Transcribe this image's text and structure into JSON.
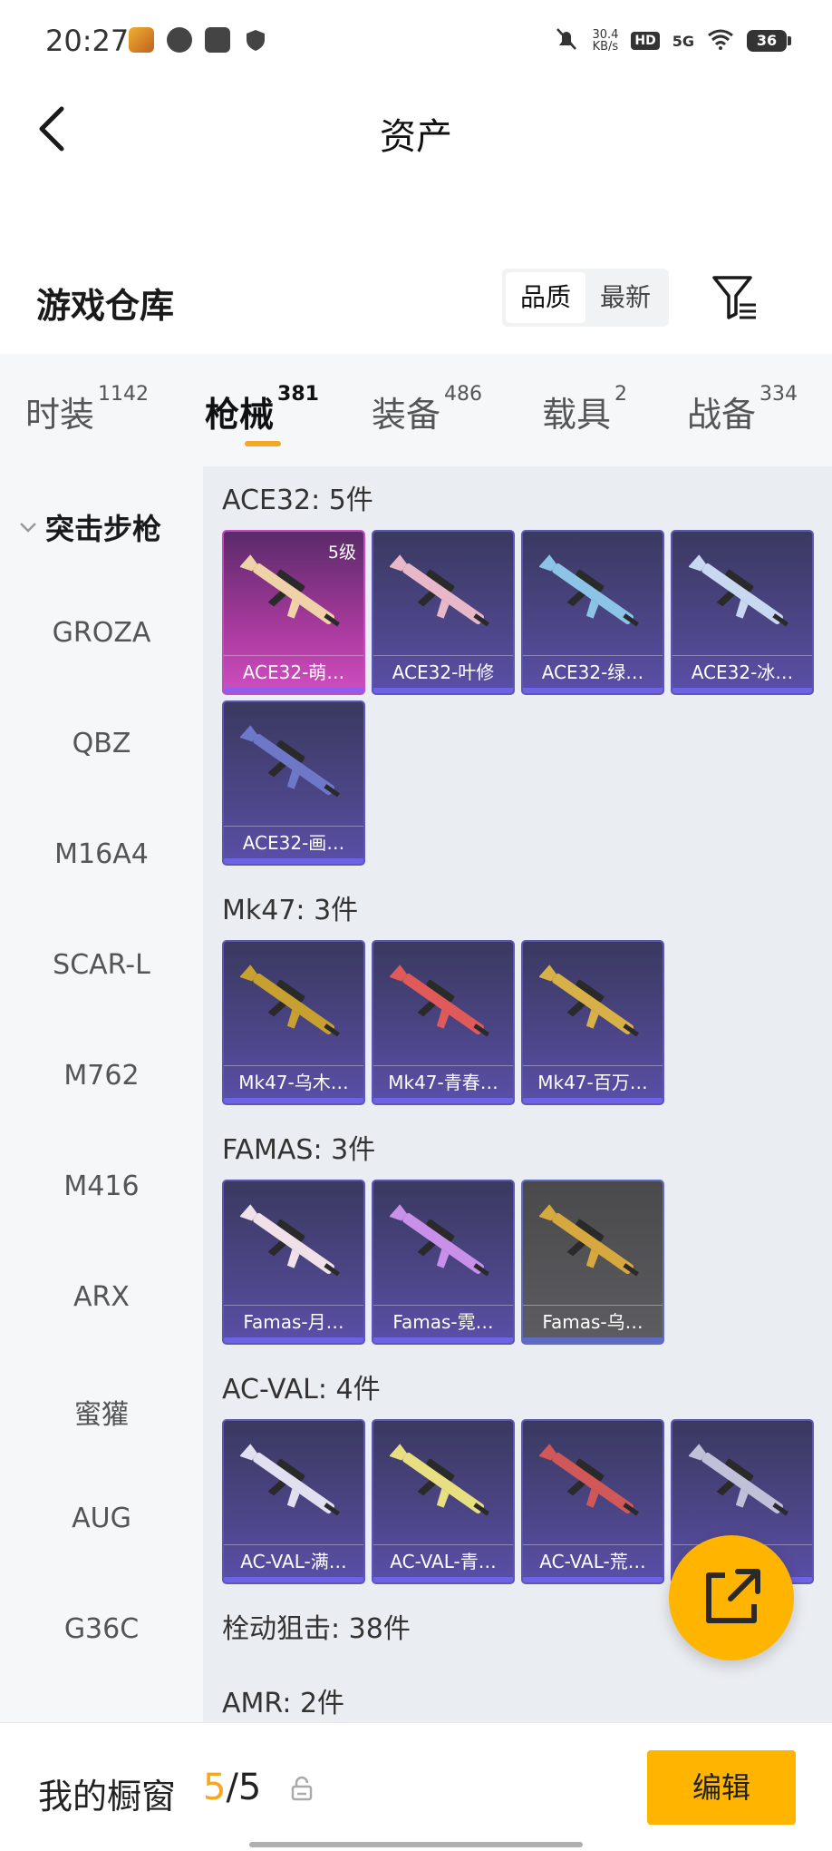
{
  "status_bar": {
    "time": "20:27",
    "net_speed_value": "30.4",
    "net_speed_unit": "KB/s",
    "hd": "HD",
    "signal": "5G",
    "battery": "36"
  },
  "header": {
    "title": "资产"
  },
  "warehouse": {
    "title": "游戏仓库",
    "sort_options": [
      "品质",
      "最新"
    ],
    "active_sort": "品质"
  },
  "tabs": [
    {
      "label": "时装",
      "count": "1142"
    },
    {
      "label": "枪械",
      "count": "381"
    },
    {
      "label": "装备",
      "count": "486"
    },
    {
      "label": "载具",
      "count": "2"
    },
    {
      "label": "战备",
      "count": "334"
    }
  ],
  "active_tab": "枪械",
  "sidebar": {
    "category": "突击步枪",
    "items": [
      "GROZA",
      "QBZ",
      "M16A4",
      "SCAR-L",
      "M762",
      "M416",
      "ARX",
      "蜜獾",
      "AUG",
      "G36C"
    ]
  },
  "groups": [
    {
      "title": "ACE32: 5件",
      "cards": [
        {
          "label": "ACE32-萌…",
          "level": "5级",
          "style": "pink",
          "gun": "#f0d2a8"
        },
        {
          "label": "ACE32-叶修",
          "style": "blue",
          "gun": "#e8b8c8"
        },
        {
          "label": "ACE32-绿…",
          "style": "blue",
          "gun": "#8cc4e8"
        },
        {
          "label": "ACE32-冰…",
          "style": "blue",
          "gun": "#c8d8f0"
        },
        {
          "label": "ACE32-画…",
          "style": "blue",
          "gun": "#6e78c8"
        }
      ]
    },
    {
      "title": "Mk47: 3件",
      "cards": [
        {
          "label": "Mk47-乌木…",
          "style": "blue",
          "gun": "#c8a030"
        },
        {
          "label": "Mk47-青春…",
          "style": "blue",
          "gun": "#e05a5a"
        },
        {
          "label": "Mk47-百万…",
          "style": "blue",
          "gun": "#d8b048"
        }
      ]
    },
    {
      "title": "FAMAS: 3件",
      "cards": [
        {
          "label": "Famas-月…",
          "style": "blue",
          "gun": "#f0e0e8"
        },
        {
          "label": "Famas-霓…",
          "style": "blue",
          "gun": "#c890e8"
        },
        {
          "label": "Famas-乌…",
          "style": "gray",
          "gun": "#d8a840"
        }
      ]
    },
    {
      "title": "AC-VAL: 4件",
      "cards": [
        {
          "label": "AC-VAL-满…",
          "style": "blue",
          "gun": "#e0e0f0"
        },
        {
          "label": "AC-VAL-青…",
          "style": "blue",
          "gun": "#e8e080"
        },
        {
          "label": "AC-VAL-荒…",
          "style": "blue",
          "gun": "#d05858"
        },
        {
          "label": "AC-VAL-…",
          "style": "blue",
          "gun": "#c0c0d8"
        }
      ]
    },
    {
      "title": "栓动狙击: 38件",
      "cards": []
    },
    {
      "title": "AMR: 2件",
      "cards": []
    }
  ],
  "bottom": {
    "showcase_label": "我的橱窗",
    "showcase_current": "5",
    "showcase_total": "/5",
    "edit_label": "编辑"
  },
  "colors": {
    "accent": "#ffb400",
    "tab_underline": "#f5a623",
    "showcase_current": "#f5a623"
  }
}
